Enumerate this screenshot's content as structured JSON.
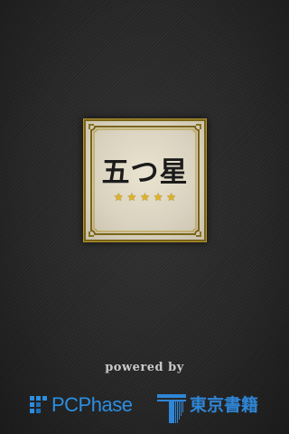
{
  "splash": {
    "title": "五つ星",
    "stars": [
      "★",
      "★",
      "★",
      "★",
      "★"
    ],
    "powered_by": "powered by"
  },
  "logos": {
    "pcphase": {
      "text": "PCPhase",
      "icon": "pcphase-logo-icon"
    },
    "tokyo_shoseki": {
      "text": "東京書籍",
      "icon": "tokyo-shoseki-logo-icon"
    }
  },
  "colors": {
    "background": "#262626",
    "gold": "#c8a43c",
    "badge": "#e2dcc8",
    "brand_blue": "#2d8ee0"
  }
}
